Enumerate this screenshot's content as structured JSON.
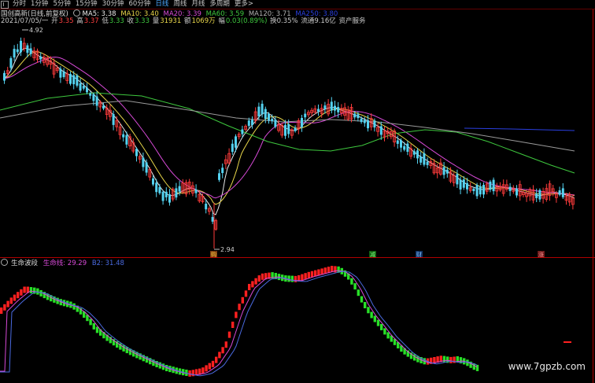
{
  "toolbar": {
    "items": [
      "分时",
      "1分钟",
      "5分钟",
      "15分钟",
      "30分钟",
      "60分钟",
      "日线",
      "周线",
      "月线",
      "多周期",
      "更多>"
    ],
    "active_index": 6
  },
  "ma_line": {
    "stock": "国创高新(日线,前复权)",
    "ma5": "MA5: 3.38",
    "ma10": "MA10: 3.40",
    "ma20": "MA20: 3.39",
    "ma60": "MA60: 3.59",
    "ma120": "MA120: 3.71",
    "ma250": "MA250: 3.80"
  },
  "quote_line": {
    "date": "2021/07/05/一",
    "open_label": "开",
    "open": "3.35",
    "high_label": "高",
    "high": "3.37",
    "low_label": "低",
    "low": "3.33",
    "close_label": "收",
    "close": "3.33",
    "volume_label": "量",
    "volume": "31931",
    "amount_label": "额",
    "amount": "1069万",
    "change_label": "幅",
    "change": "0.03(0.89%)",
    "turnover": "换0.35%",
    "float_cap": "流通9.16亿",
    "service": "资产服务"
  },
  "annotations": {
    "high_price": "4.92",
    "low_price": "2.94",
    "markers": [
      "购",
      "减",
      "财",
      "涨"
    ]
  },
  "indicator": {
    "name": "生命波段",
    "line1": "生命线: 29.29",
    "line2": "B2: 31.48"
  },
  "colors": {
    "up": "#ff3b3b",
    "down": "#54d2f0",
    "ma5": "#e8e8e8",
    "ma10": "#e8d64a",
    "ma20": "#d74ad7",
    "ma60": "#3ec83e",
    "ma120": "#8a8a8a",
    "ma250": "#2a3fe0",
    "bar_up": "#ff2020",
    "bar_down": "#28e028",
    "frame": "#c00000"
  },
  "watermark": "www.7gpzb.com"
}
